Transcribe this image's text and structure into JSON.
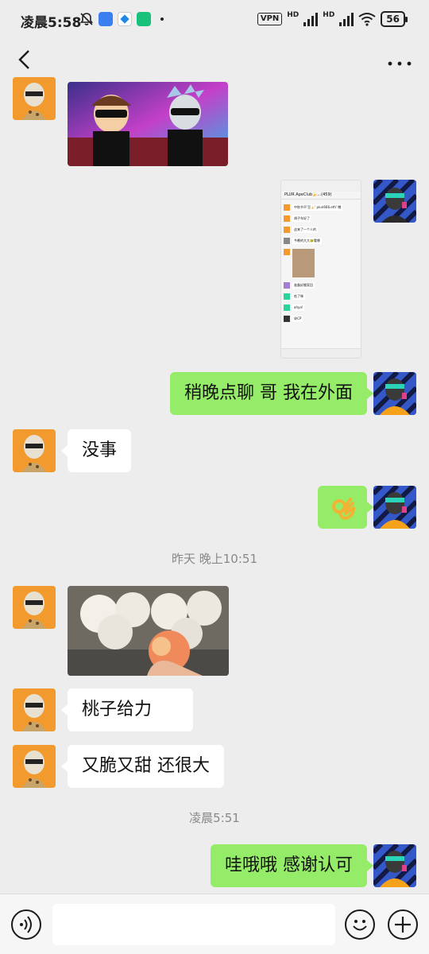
{
  "status_bar": {
    "time": "凌晨5:58",
    "vpn": "VPN",
    "network_1": "HD",
    "network_2": "HD",
    "battery": "56",
    "icons": [
      "bell-off-icon",
      "app-icon-blue",
      "app-icon-diamond",
      "app-icon-shield",
      "dot-icon",
      "signal-icon",
      "wifi-icon"
    ]
  },
  "nav": {
    "back_icon": "chevron-left-icon",
    "more_icon": "more-dots-icon"
  },
  "messages": [
    {
      "side": "left",
      "type": "image",
      "description_icon": "cartoon-image"
    },
    {
      "side": "right",
      "type": "image",
      "description_icon": "screenshot-image",
      "screenshot": {
        "title": "PLUR ApeClub🍌...(459)",
        "lines": [
          "中秋节不'豆🍌' pluri666.eth' 瞧",
          "胡子车好了",
          "这来了一个人的",
          "今晚的大大🐸看哪",
          "节目好来...",
          "准备好搬家回",
          "吃了咪",
          "ahya!",
          "😁CP"
        ]
      }
    },
    {
      "side": "right",
      "type": "text",
      "text": "稍晚点聊 哥  我在外面"
    },
    {
      "side": "left",
      "type": "text",
      "text": "没事"
    },
    {
      "side": "right",
      "type": "emoji",
      "text": "👌"
    },
    {
      "type": "timestamp",
      "text": "昨天 晚上10:51"
    },
    {
      "side": "left",
      "type": "image",
      "description_icon": "peach-photo"
    },
    {
      "side": "left",
      "type": "text",
      "text": "桃子给力"
    },
    {
      "side": "left",
      "type": "text",
      "text": "又脆又甜 还很大"
    },
    {
      "type": "timestamp",
      "text": "凌晨5:51"
    },
    {
      "side": "right",
      "type": "text",
      "text": "哇哦哦 感谢认可"
    }
  ],
  "input_bar": {
    "voice_icon": "voice-icon",
    "emoji_icon": "emoji-icon",
    "plus_icon": "plus-icon",
    "input_value": ""
  },
  "colors": {
    "background": "#ededed",
    "sent_bubble": "#95ec69",
    "received_bubble": "#ffffff",
    "left_avatar_bg": "#f29a2e",
    "right_avatar_bg": "#3558c9"
  }
}
